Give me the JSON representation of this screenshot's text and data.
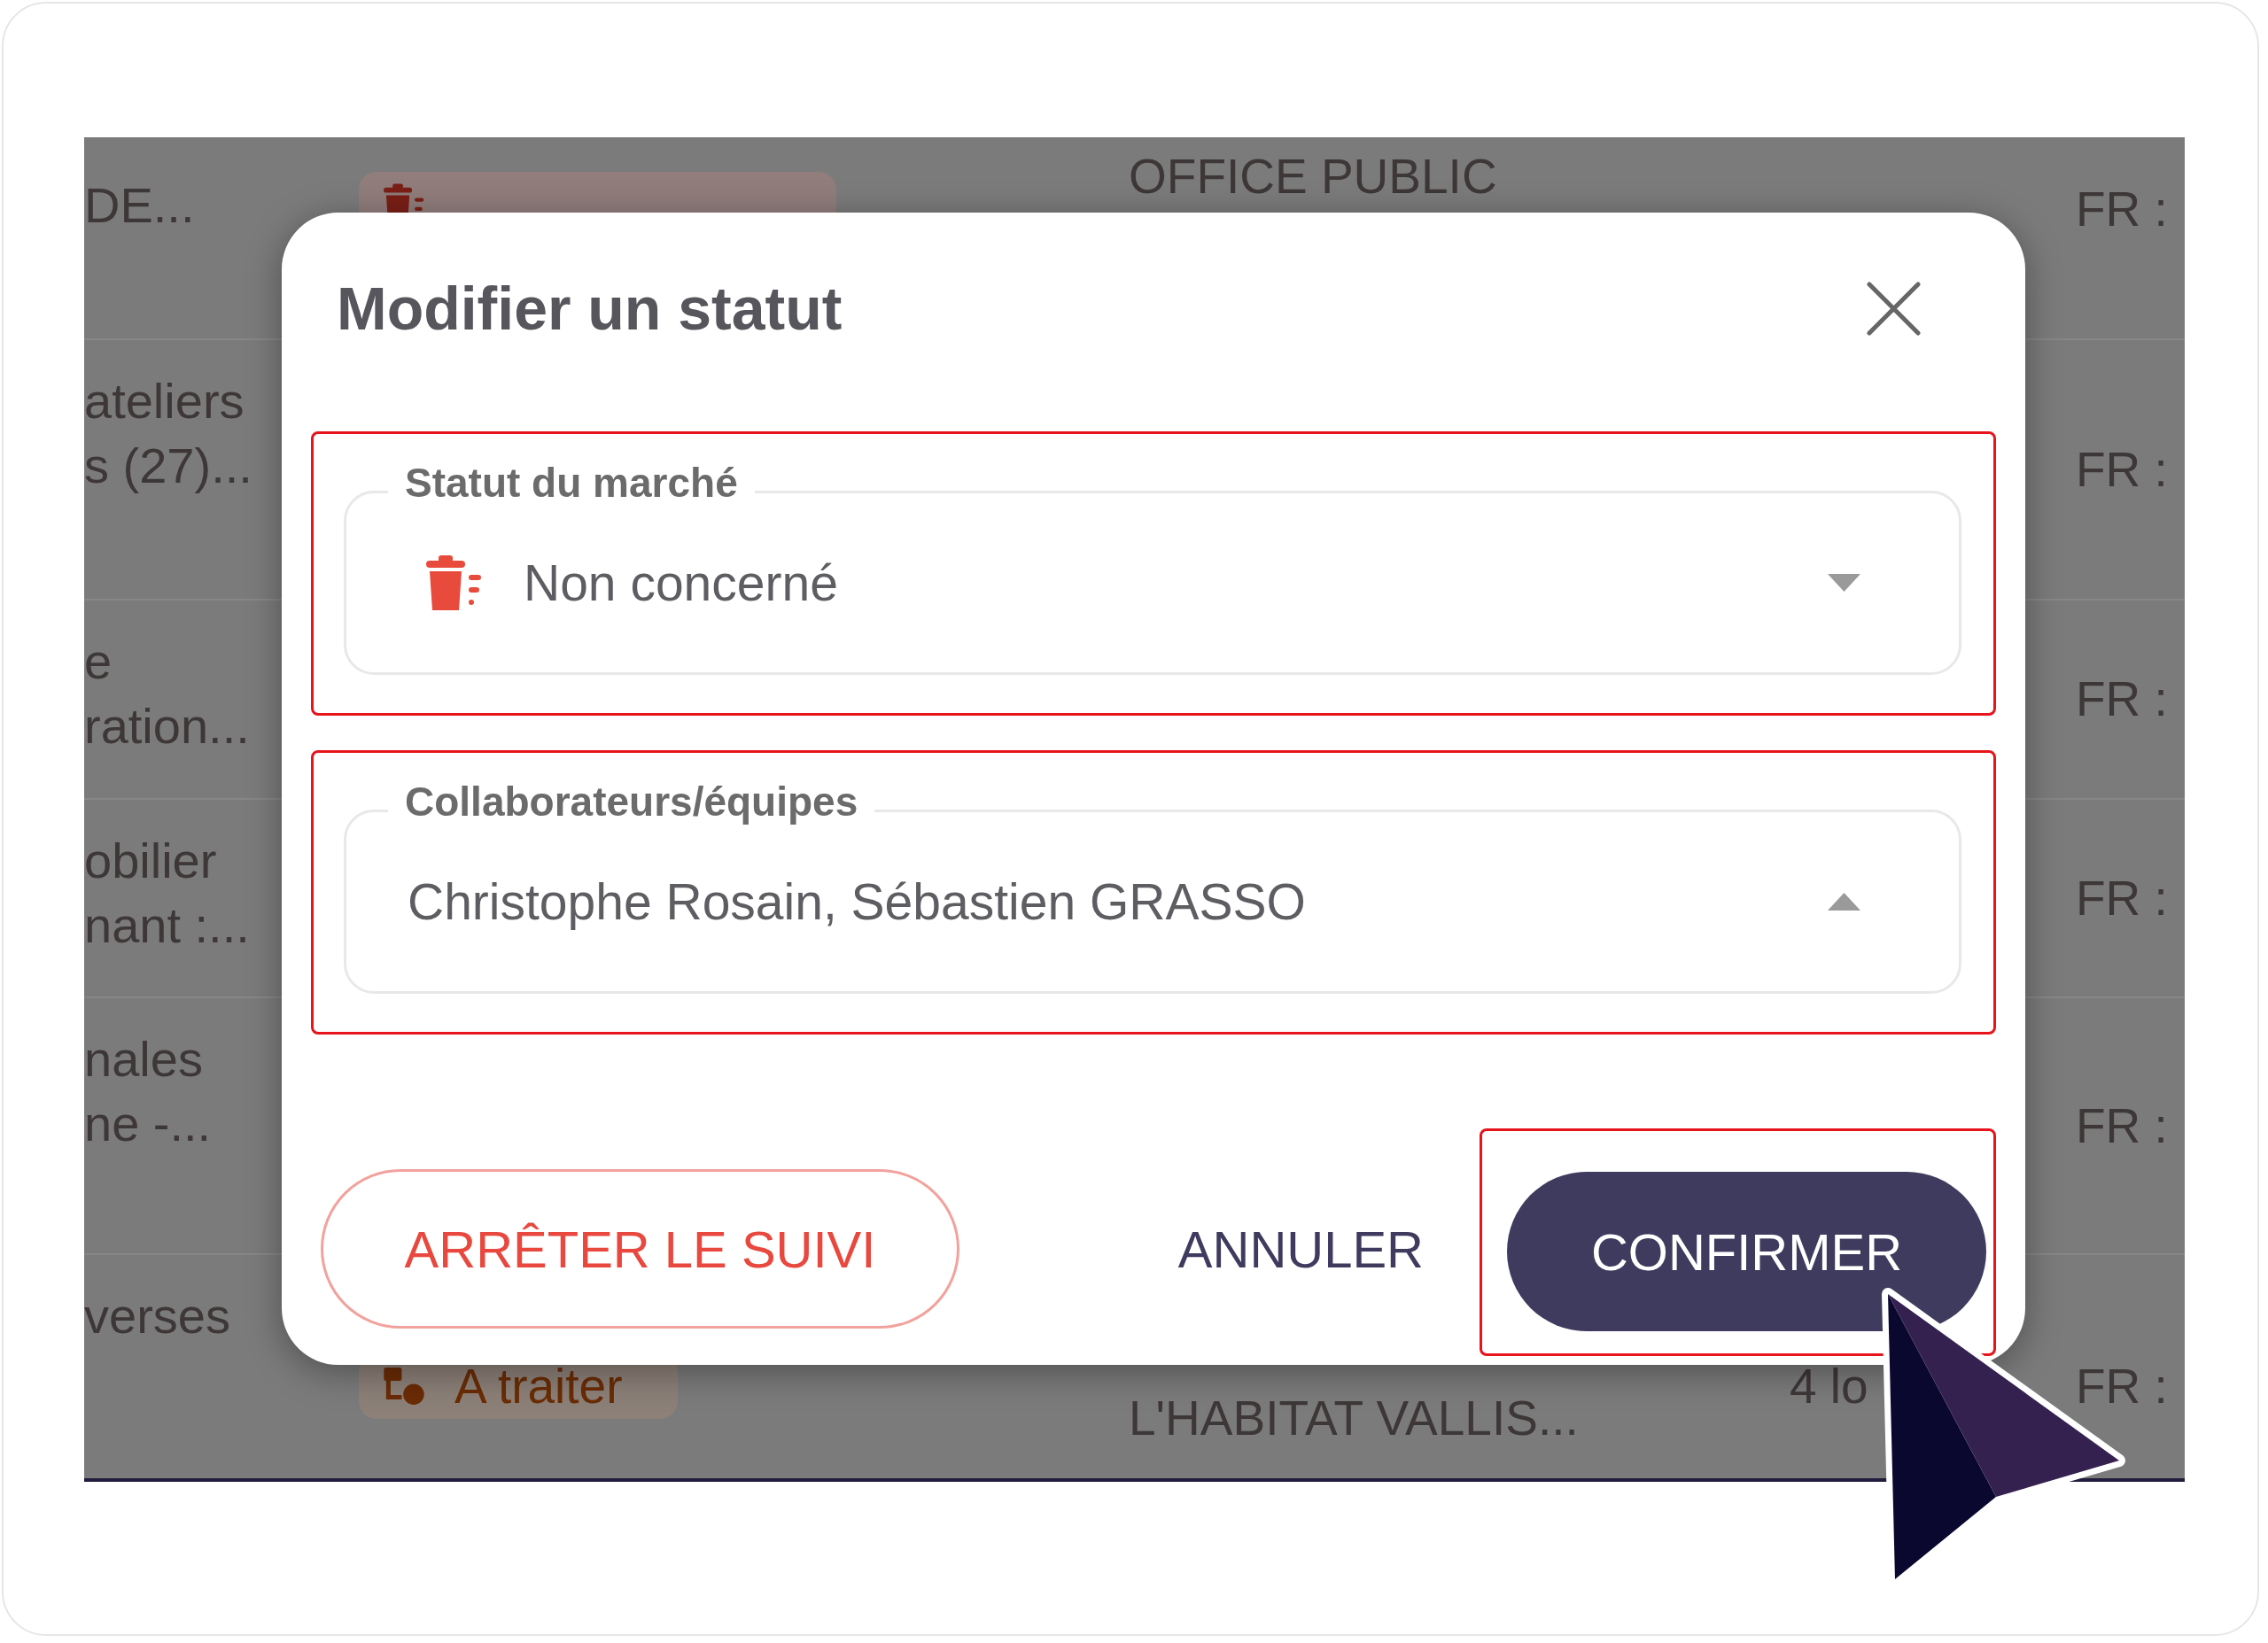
{
  "table": {
    "rows": [
      {
        "column_1": [
          "DE..."
        ],
        "column_2": {
          "kind": "excluded",
          "color": "#7a1f16"
        },
        "column_3": "OFFICE PUBLIC",
        "column_5": "FR :"
      },
      {
        "column_1": [
          "ateliers",
          "s (27)..."
        ],
        "column_5": "FR :"
      },
      {
        "column_1": [
          "e",
          "ration..."
        ],
        "column_5": "FR :"
      },
      {
        "column_1": [
          "obilier",
          "nant :..."
        ],
        "column_5": "FR :"
      },
      {
        "column_1": [
          "nales",
          "ne -..."
        ],
        "column_5": "FR :"
      },
      {
        "column_1": [
          "verses"
        ],
        "column_2": {
          "kind": "pending",
          "label": "A traiter",
          "color": "#6a2c05"
        },
        "column_3": "L'HABITAT VALLIS...",
        "column_4": "4 lo",
        "column_5": "FR :"
      }
    ]
  },
  "dialog": {
    "title": "Modifier un statut",
    "fields": [
      {
        "kind": "status",
        "label": "Statut du marché",
        "value": "Non concerné",
        "expanded": false,
        "highlighted": true
      },
      {
        "kind": "people",
        "label": "Collaborateurs/équipes",
        "value": "Christophe Rosain, Sébastien GRASSO",
        "expanded": true,
        "highlighted": true
      }
    ],
    "buttons": [
      {
        "kind": "outlined",
        "label": "ARRÊTER LE SUIVI",
        "highlighted": false
      },
      {
        "kind": "text",
        "label": "ANNULER",
        "highlighted": false
      },
      {
        "kind": "filled",
        "label": "CONFIRMER",
        "highlighted": true
      }
    ]
  }
}
